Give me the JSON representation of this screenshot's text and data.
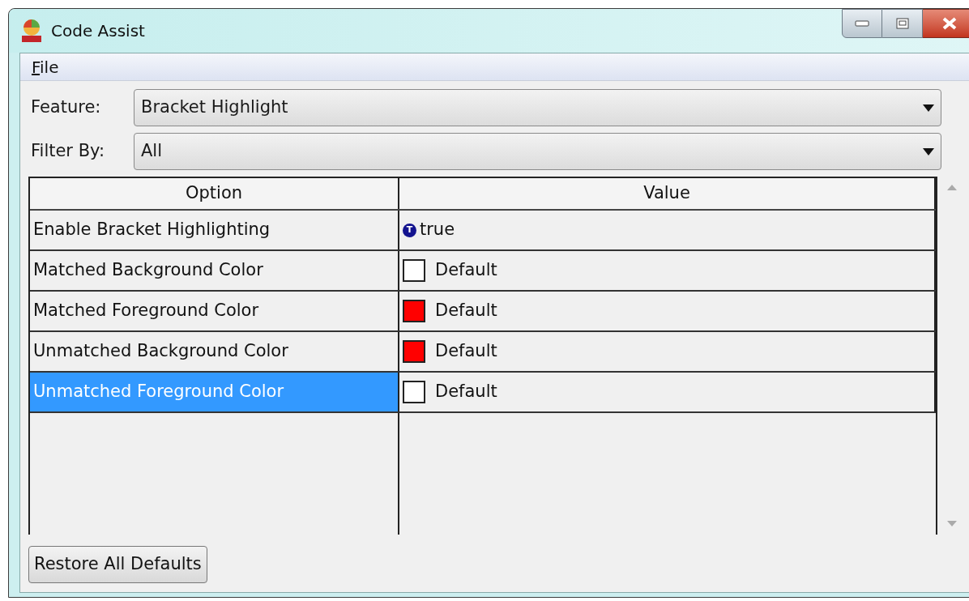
{
  "window": {
    "title": "Code Assist"
  },
  "menu": [
    {
      "label": "File"
    }
  ],
  "feature": {
    "label": "Feature:",
    "value": "Bracket Highlight"
  },
  "filter": {
    "label": "Filter By:",
    "value": "All"
  },
  "table": {
    "columns": [
      "Option",
      "Value"
    ],
    "rows": [
      {
        "option": "Enable Bracket Highlighting",
        "kind": "boolean",
        "icon_letter": "T",
        "value": "true",
        "selected": false
      },
      {
        "option": "Matched Background Color",
        "kind": "color",
        "color": "#ffffff",
        "value": "Default",
        "selected": false
      },
      {
        "option": "Matched Foreground Color",
        "kind": "color",
        "color": "#ff0000",
        "value": "Default",
        "selected": false
      },
      {
        "option": "Unmatched Background Color",
        "kind": "color",
        "color": "#ff0000",
        "value": "Default",
        "selected": false
      },
      {
        "option": "Unmatched Foreground Color",
        "kind": "color",
        "color": "#ffffff",
        "value": "Default",
        "selected": true
      }
    ]
  },
  "buttons": [
    "Restore All Defaults"
  ]
}
